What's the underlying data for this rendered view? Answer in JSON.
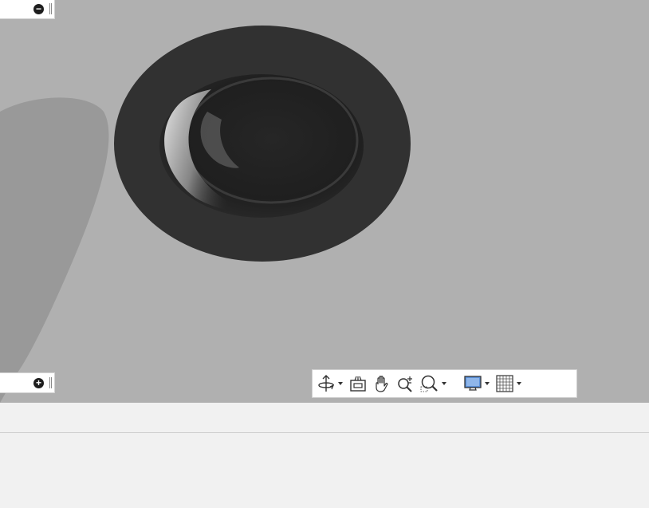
{
  "viewport": {
    "background": "#b0b0b0",
    "model": {
      "name": "dish-model",
      "outer_color": "#313131",
      "inner_color": "#1e1e1e"
    }
  },
  "browser_tabs": {
    "top": {
      "icon": "collapse-minus-icon",
      "glyph": "−"
    },
    "bottom": {
      "icon": "expand-plus-icon",
      "glyph": "+"
    }
  },
  "nav_bar": {
    "items": [
      {
        "id": "orbit",
        "icon": "orbit-icon",
        "has_dropdown": true
      },
      {
        "id": "look-at",
        "icon": "look-at-icon",
        "has_dropdown": false
      },
      {
        "id": "pan",
        "icon": "pan-hand-icon",
        "has_dropdown": false
      },
      {
        "id": "zoom",
        "icon": "zoom-icon",
        "has_dropdown": false
      },
      {
        "id": "fit",
        "icon": "zoom-window-icon",
        "has_dropdown": true
      },
      {
        "id": "display",
        "icon": "display-settings-icon",
        "has_dropdown": true
      },
      {
        "id": "grid",
        "icon": "grid-icon",
        "has_dropdown": true
      }
    ]
  },
  "status_bar": {
    "text": ""
  },
  "colors": {
    "panel": "#f1f1f1",
    "display_icon_blue": "#5a8fd8"
  }
}
